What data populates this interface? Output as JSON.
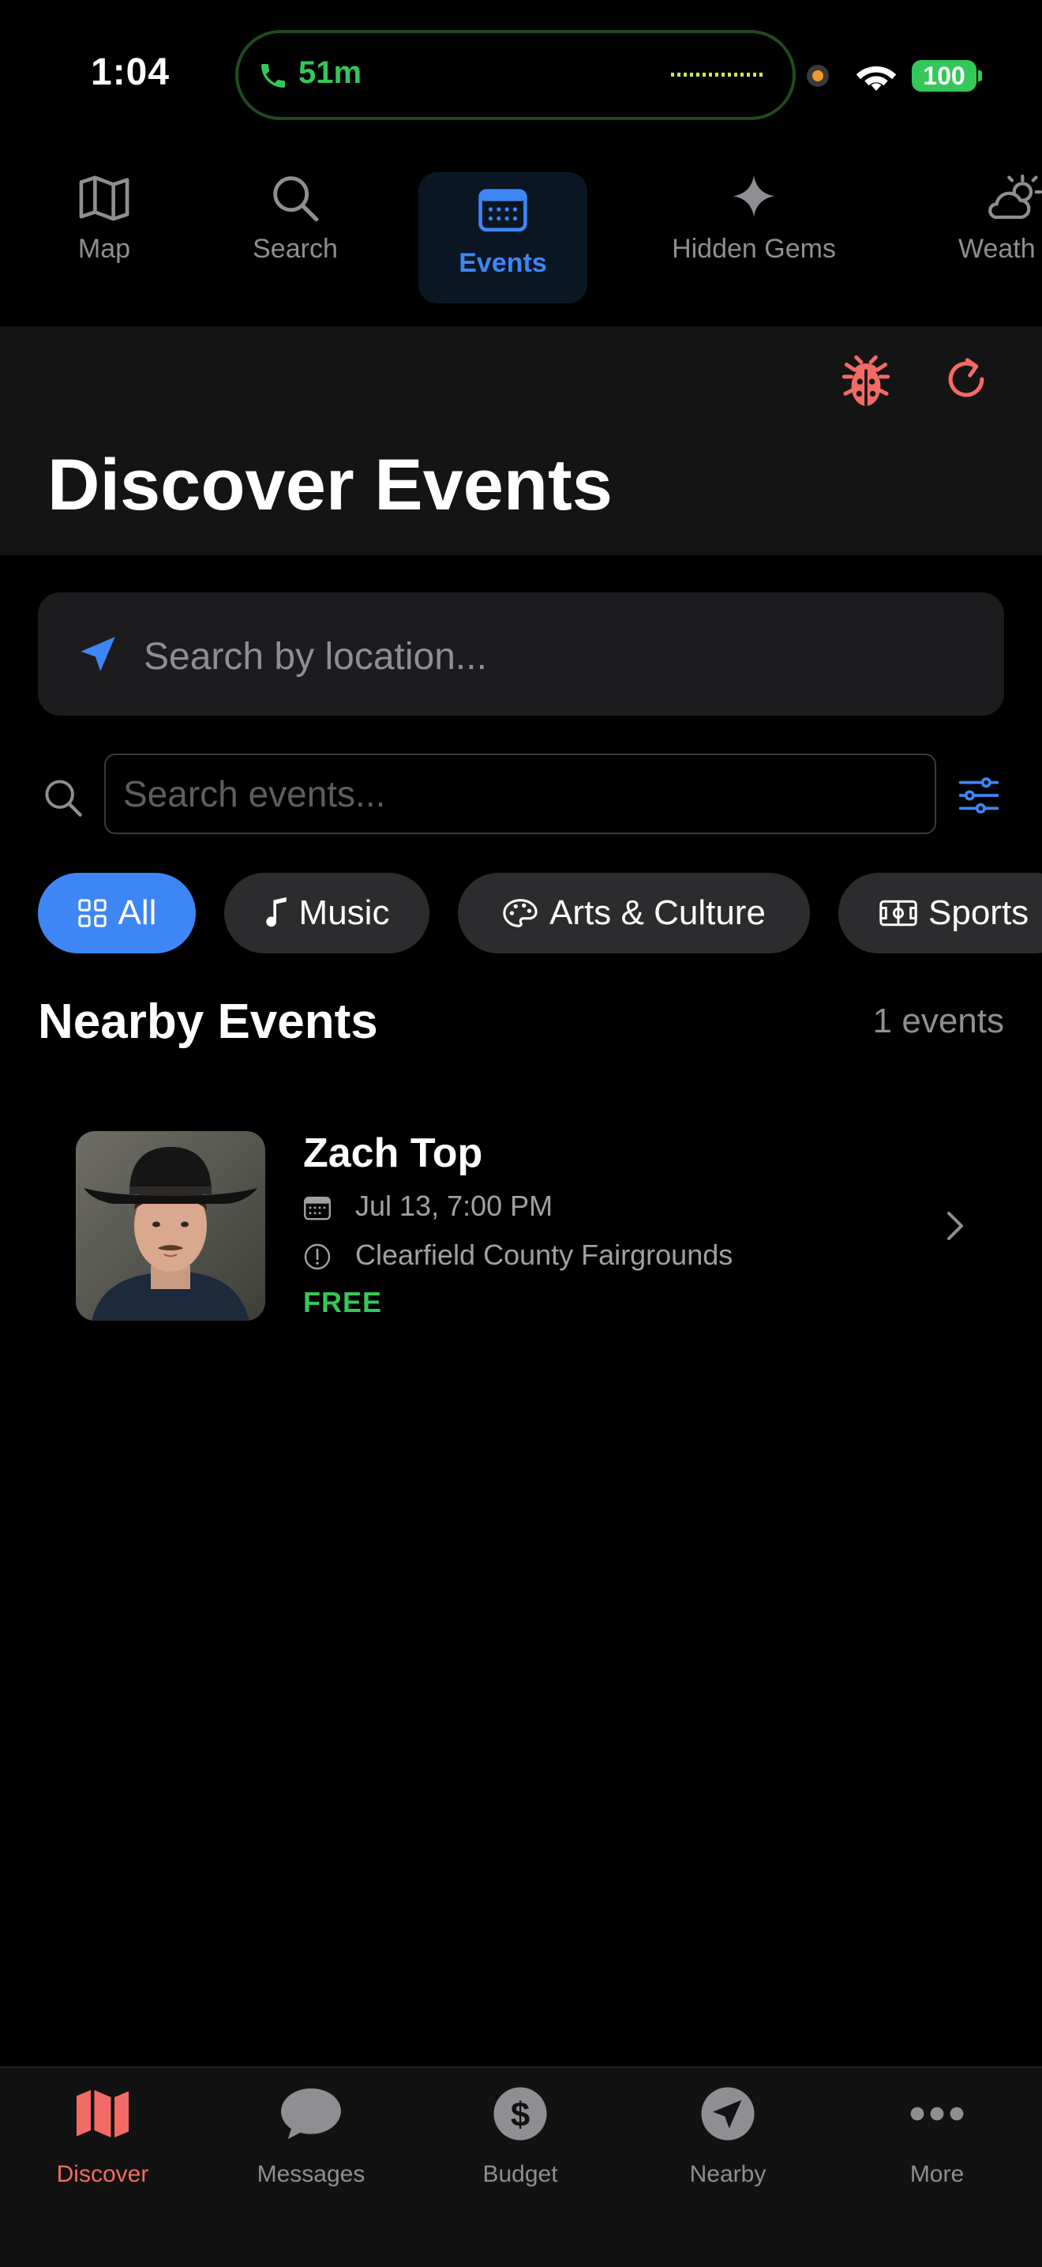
{
  "status_bar": {
    "time": "1:04",
    "call_duration": "51m",
    "battery": "100"
  },
  "top_tabs": [
    {
      "label": "Map",
      "icon": "map-icon"
    },
    {
      "label": "Search",
      "icon": "search-icon"
    },
    {
      "label": "Events",
      "icon": "calendar-icon",
      "active": true
    },
    {
      "label": "Hidden Gems",
      "icon": "sparkle-icon"
    },
    {
      "label": "Weath",
      "icon": "cloud-sun-icon"
    }
  ],
  "header": {
    "title": "Discover Events",
    "actions": [
      "bug-icon",
      "refresh-icon"
    ]
  },
  "location_search": {
    "placeholder": "Search by location..."
  },
  "event_search": {
    "placeholder": "Search events..."
  },
  "categories": [
    {
      "label": "All",
      "icon": "grid-icon",
      "active": true
    },
    {
      "label": "Music",
      "icon": "music-note-icon"
    },
    {
      "label": "Arts & Culture",
      "icon": "palette-icon"
    },
    {
      "label": "Sports",
      "icon": "stadium-icon"
    }
  ],
  "section": {
    "title": "Nearby Events",
    "count": "1 events"
  },
  "events": [
    {
      "title": "Zach Top",
      "date": "Jul 13, 7:00 PM",
      "venue": "Clearfield County Fairgrounds",
      "price": "FREE"
    }
  ],
  "bottom_tabs": [
    {
      "label": "Discover",
      "icon": "map-fold-icon",
      "active": true
    },
    {
      "label": "Messages",
      "icon": "chat-bubble-icon"
    },
    {
      "label": "Budget",
      "icon": "dollar-icon"
    },
    {
      "label": "Nearby",
      "icon": "location-arrow-icon"
    },
    {
      "label": "More",
      "icon": "more-dots-icon"
    }
  ],
  "colors": {
    "accent": "#3e86f5",
    "discover_active": "#f26b65",
    "price_free": "#34c759",
    "call_green": "#34c759"
  }
}
